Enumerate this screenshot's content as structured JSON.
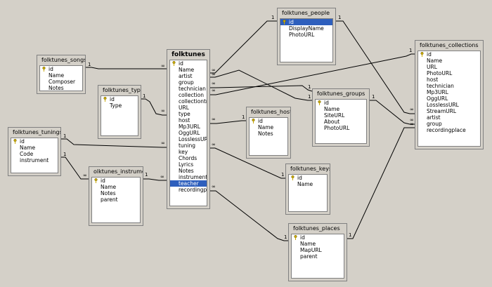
{
  "tables": {
    "folktunes": {
      "title": "folktunes",
      "rows": [
        "id",
        "Name",
        "artist",
        "group",
        "technician",
        "collection",
        "collectiontrac",
        "URL",
        "type",
        "host",
        "Mp3URL",
        "OggURL",
        "LosslessURL",
        "tuning",
        "key",
        "Chords",
        "Lyrics",
        "Notes",
        "instrument",
        "teacher",
        "recordingplac"
      ]
    },
    "songs": {
      "title": "folktunes_songs",
      "rows": [
        "id",
        "Name",
        "Composer",
        "Notes"
      ]
    },
    "types": {
      "title": "folktunes_types",
      "rows": [
        "id",
        "Type"
      ]
    },
    "tunings": {
      "title": "folktunes_tunings",
      "rows": [
        "id",
        "Name",
        "Code",
        "instrument"
      ]
    },
    "instruments": {
      "title": "olktunes_instrumen",
      "rows": [
        "id",
        "Name",
        "Notes",
        "parent"
      ]
    },
    "people": {
      "title": "folktunes_people",
      "rows": [
        "id",
        "DisplayName",
        "PhotoURL"
      ]
    },
    "hosts": {
      "title": "folktunes_hosts",
      "rows": [
        "id",
        "Name",
        "Notes"
      ]
    },
    "groups": {
      "title": "folktunes_groups",
      "rows": [
        "id",
        "Name",
        "SiteURL",
        "About",
        "PhotoURL"
      ]
    },
    "keys": {
      "title": "folktunes_keys",
      "rows": [
        "id",
        "Name"
      ]
    },
    "places": {
      "title": "folktunes_places",
      "rows": [
        "id",
        "Name",
        "MapURL",
        "parent"
      ]
    },
    "collections": {
      "title": "folktunes_collections",
      "rows": [
        "id",
        "Name",
        "URL",
        "PhotoURL",
        "host",
        "technician",
        "Mp3URL",
        "OggURL",
        "LosslessURL",
        "StreamURL",
        "artist",
        "group",
        "recordingplace"
      ]
    }
  },
  "cardinality": {
    "one": "1",
    "many": "∞"
  },
  "colors": {
    "selection": "#2e5fbd",
    "background": "#d4d0c8",
    "key": "#c8a800"
  }
}
